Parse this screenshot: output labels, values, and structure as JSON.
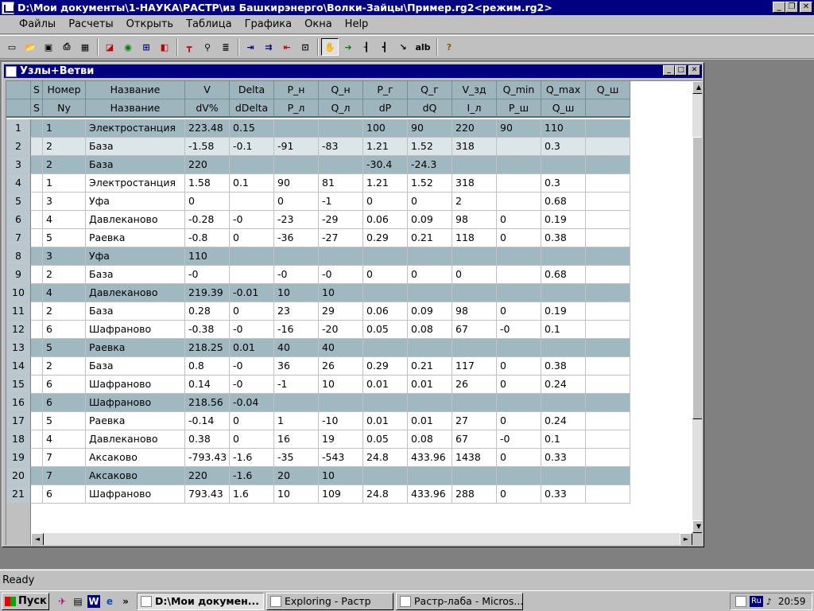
{
  "app": {
    "title": "D:\\Мои документы\\1-НАУКА\\РАСТР\\из Башкирэнерго\\Волки-Зайцы\\Пример.rg2<режим.rg2>",
    "minimize": "_",
    "restore": "❐",
    "close": "✕"
  },
  "menu": [
    "Файлы",
    "Расчеты",
    "Открыть",
    "Таблица",
    "Графика",
    "Окна",
    "Help"
  ],
  "toolbar": {
    "icons": [
      "new-file-icon",
      "open-folder-icon",
      "save-disk-icon",
      "print-icon",
      "table-icon",
      "graph-icon",
      "calc-icon",
      "network-icon",
      "branch-icon",
      "pin-icon",
      "binoculars-icon",
      "document-list-icon",
      "node-add-icon",
      "node-link-icon",
      "node-remove-icon",
      "node-select-icon",
      "hand-pan-icon",
      "arrow-right-icon",
      "branch-node-icon",
      "switch-icon",
      "cursor-node-icon",
      "alb-icon",
      "help-icon"
    ],
    "alb_label": "alb",
    "help_label": "?"
  },
  "child": {
    "title": "Узлы+Ветви"
  },
  "grid": {
    "header1": [
      "S",
      "Номер",
      "Название",
      "V",
      "Delta",
      "P_н",
      "Q_н",
      "P_г",
      "Q_г",
      "V_зд",
      "Q_min",
      "Q_max",
      "Q_ш"
    ],
    "header2": [
      "S",
      "Ny",
      "Название",
      "dV%",
      "dDelta",
      "P_л",
      "Q_л",
      "dP",
      "dQ",
      "I_л",
      "P_ш",
      "Q_ш",
      ""
    ],
    "rows": [
      {
        "n": "1",
        "kind": "node",
        "c": [
          "",
          "1",
          "Электростанция",
          "223.48",
          "0.15",
          "",
          "",
          "100",
          "90",
          "220",
          "90",
          "110",
          ""
        ]
      },
      {
        "n": "2",
        "kind": "sel",
        "c": [
          "",
          "2",
          "База",
          "-1.58",
          "-0.1",
          "-91",
          "-83",
          "1.21",
          "1.52",
          "318",
          "",
          "0.3",
          ""
        ]
      },
      {
        "n": "3",
        "kind": "node",
        "c": [
          "",
          "2",
          "База",
          "220",
          "",
          "",
          "",
          "-30.4",
          "-24.3",
          "",
          "",
          "",
          ""
        ]
      },
      {
        "n": "4",
        "kind": "branch",
        "c": [
          "",
          "1",
          "Электростанция",
          "1.58",
          "0.1",
          "90",
          "81",
          "1.21",
          "1.52",
          "318",
          "",
          "0.3",
          ""
        ]
      },
      {
        "n": "5",
        "kind": "branch",
        "c": [
          "",
          "3",
          "Уфа",
          "0",
          "",
          "0",
          "-1",
          "0",
          "0",
          "2",
          "",
          "0.68",
          ""
        ]
      },
      {
        "n": "6",
        "kind": "branch",
        "c": [
          "",
          "4",
          "Давлеканово",
          "-0.28",
          "-0",
          "-23",
          "-29",
          "0.06",
          "0.09",
          "98",
          "0",
          "0.19",
          ""
        ]
      },
      {
        "n": "7",
        "kind": "branch",
        "c": [
          "",
          "5",
          "Раевка",
          "-0.8",
          "0",
          "-36",
          "-27",
          "0.29",
          "0.21",
          "118",
          "0",
          "0.38",
          ""
        ]
      },
      {
        "n": "8",
        "kind": "node",
        "c": [
          "",
          "3",
          "Уфа",
          "110",
          "",
          "",
          "",
          "",
          "",
          "",
          "",
          "",
          ""
        ]
      },
      {
        "n": "9",
        "kind": "branch",
        "c": [
          "",
          "2",
          "База",
          "-0",
          "",
          "-0",
          "-0",
          "0",
          "0",
          "0",
          "",
          "0.68",
          ""
        ]
      },
      {
        "n": "10",
        "kind": "node",
        "c": [
          "",
          "4",
          "Давлеканово",
          "219.39",
          "-0.01",
          "10",
          "10",
          "",
          "",
          "",
          "",
          "",
          ""
        ]
      },
      {
        "n": "11",
        "kind": "branch",
        "c": [
          "",
          "2",
          "База",
          "0.28",
          "0",
          "23",
          "29",
          "0.06",
          "0.09",
          "98",
          "0",
          "0.19",
          ""
        ]
      },
      {
        "n": "12",
        "kind": "branch",
        "c": [
          "",
          "6",
          "Шафраново",
          "-0.38",
          "-0",
          "-16",
          "-20",
          "0.05",
          "0.08",
          "67",
          "-0",
          "0.1",
          ""
        ]
      },
      {
        "n": "13",
        "kind": "node",
        "c": [
          "",
          "5",
          "Раевка",
          "218.25",
          "0.01",
          "40",
          "40",
          "",
          "",
          "",
          "",
          "",
          ""
        ]
      },
      {
        "n": "14",
        "kind": "branch",
        "c": [
          "",
          "2",
          "База",
          "0.8",
          "-0",
          "36",
          "26",
          "0.29",
          "0.21",
          "117",
          "0",
          "0.38",
          ""
        ]
      },
      {
        "n": "15",
        "kind": "branch",
        "c": [
          "",
          "6",
          "Шафраново",
          "0.14",
          "-0",
          "-1",
          "10",
          "0.01",
          "0.01",
          "26",
          "0",
          "0.24",
          ""
        ]
      },
      {
        "n": "16",
        "kind": "node",
        "c": [
          "",
          "6",
          "Шафраново",
          "218.56",
          "-0.04",
          "",
          "",
          "",
          "",
          "",
          "",
          "",
          ""
        ]
      },
      {
        "n": "17",
        "kind": "branch",
        "c": [
          "",
          "5",
          "Раевка",
          "-0.14",
          "0",
          "1",
          "-10",
          "0.01",
          "0.01",
          "27",
          "0",
          "0.24",
          ""
        ]
      },
      {
        "n": "18",
        "kind": "branch",
        "c": [
          "",
          "4",
          "Давлеканово",
          "0.38",
          "0",
          "16",
          "19",
          "0.05",
          "0.08",
          "67",
          "-0",
          "0.1",
          ""
        ]
      },
      {
        "n": "19",
        "kind": "branch",
        "c": [
          "",
          "7",
          "Аксаково",
          "-793.43",
          "-1.6",
          "-35",
          "-543",
          "24.8",
          "433.96",
          "1438",
          "0",
          "0.33",
          ""
        ]
      },
      {
        "n": "20",
        "kind": "node",
        "c": [
          "",
          "7",
          "Аксаково",
          "220",
          "-1.6",
          "20",
          "10",
          "",
          "",
          "",
          "",
          "",
          ""
        ]
      },
      {
        "n": "21",
        "kind": "branch",
        "c": [
          "",
          "6",
          "Шафраново",
          "793.43",
          "1.6",
          "10",
          "109",
          "24.8",
          "433.96",
          "288",
          "0",
          "0.33",
          ""
        ]
      }
    ]
  },
  "scroll": {
    "up": "▲",
    "down": "▼",
    "left": "◄",
    "right": "►"
  },
  "status": {
    "text": "Ready"
  },
  "taskbar": {
    "start": "Пуск",
    "quicklaunch": [
      "bird-icon",
      "explorer-icon",
      "word-icon",
      "ie-icon"
    ],
    "more": "»",
    "tasks": [
      {
        "label": "D:\\Мои докумен...",
        "active": true
      },
      {
        "label": "Exploring - Растр",
        "active": false
      },
      {
        "label": "Растр-лаба - Micros...",
        "active": false
      }
    ],
    "tray_lang": "Ru",
    "clock": "20:59"
  },
  "colors": {
    "titlebar": "#000080",
    "node_row": "#a0b8c0",
    "selected_row": "#dce6e8",
    "header": "#9fb5bd"
  }
}
